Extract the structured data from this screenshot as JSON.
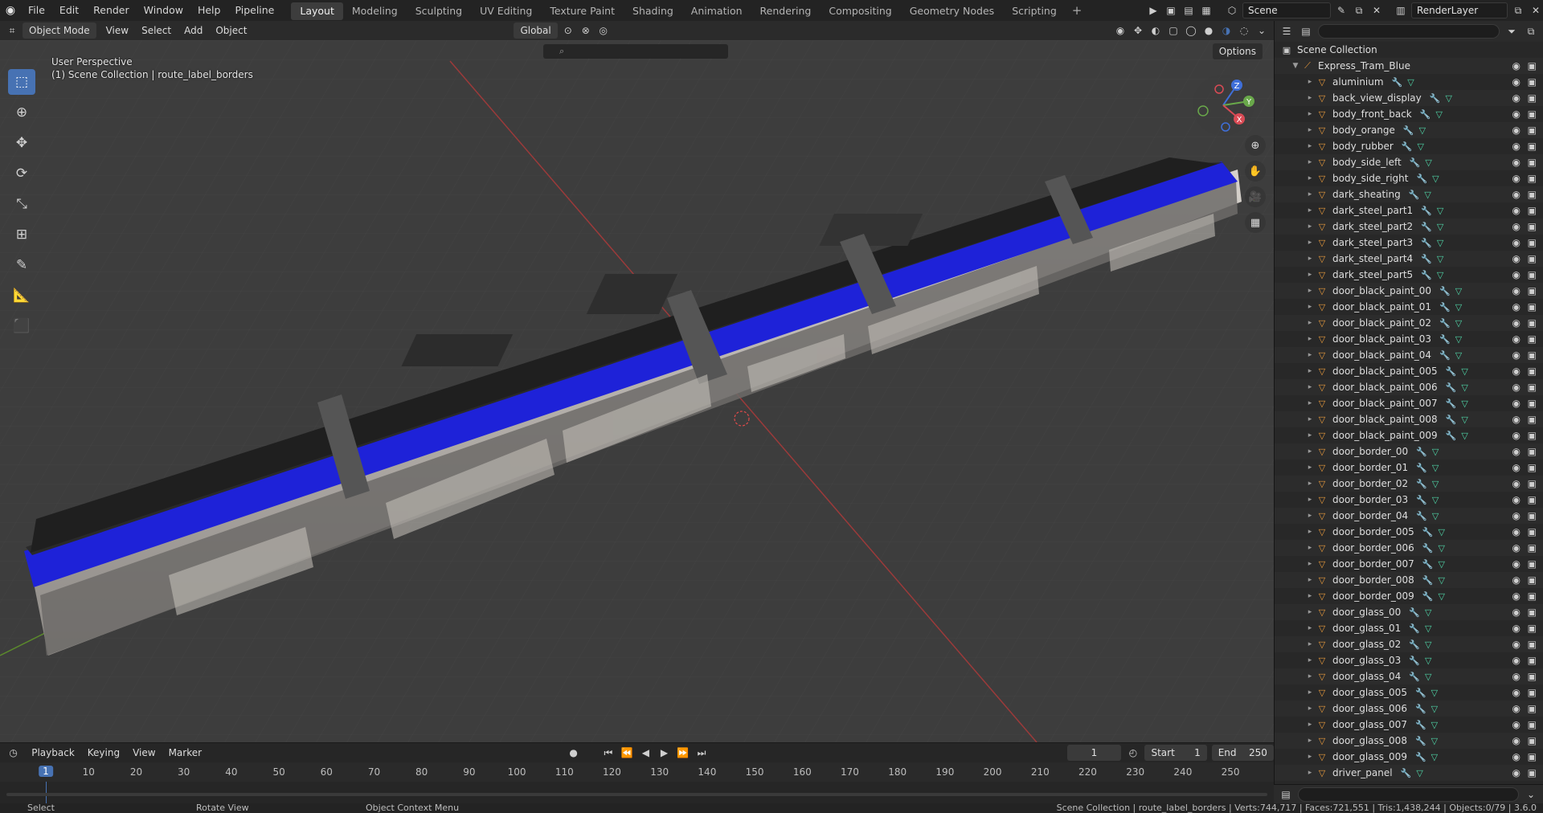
{
  "topbar": {
    "menus": [
      "File",
      "Edit",
      "Render",
      "Window",
      "Help",
      "Pipeline"
    ],
    "workspaces": [
      "Layout",
      "Modeling",
      "Sculpting",
      "UV Editing",
      "Texture Paint",
      "Shading",
      "Animation",
      "Rendering",
      "Compositing",
      "Geometry Nodes",
      "Scripting"
    ],
    "active_workspace": "Layout",
    "scene": "Scene",
    "view_layer": "RenderLayer"
  },
  "viewport": {
    "mode": "Object Mode",
    "menus": [
      "View",
      "Select",
      "Add",
      "Object"
    ],
    "transform_orientation": "Global",
    "options_label": "Options",
    "view_name": "User Perspective",
    "collection_path": "(1) Scene Collection | route_label_borders"
  },
  "outliner": {
    "root": "Scene Collection",
    "collection": "Express_Tram_Blue",
    "items": [
      "aluminium",
      "back_view_display",
      "body_front_back",
      "body_orange",
      "body_rubber",
      "body_side_left",
      "body_side_right",
      "dark_sheating",
      "dark_steel_part1",
      "dark_steel_part2",
      "dark_steel_part3",
      "dark_steel_part4",
      "dark_steel_part5",
      "door_black_paint_00",
      "door_black_paint_01",
      "door_black_paint_02",
      "door_black_paint_03",
      "door_black_paint_04",
      "door_black_paint_005",
      "door_black_paint_006",
      "door_black_paint_007",
      "door_black_paint_008",
      "door_black_paint_009",
      "door_border_00",
      "door_border_01",
      "door_border_02",
      "door_border_03",
      "door_border_04",
      "door_border_005",
      "door_border_006",
      "door_border_007",
      "door_border_008",
      "door_border_009",
      "door_glass_00",
      "door_glass_01",
      "door_glass_02",
      "door_glass_03",
      "door_glass_04",
      "door_glass_005",
      "door_glass_006",
      "door_glass_007",
      "door_glass_008",
      "door_glass_009",
      "driver_panel"
    ]
  },
  "timeline": {
    "menus": [
      "Playback",
      "Keying",
      "View",
      "Marker"
    ],
    "current_frame": "1",
    "start_label": "Start",
    "start": "1",
    "end_label": "End",
    "end": "250",
    "ruler": [
      "10",
      "20",
      "30",
      "40",
      "50",
      "60",
      "70",
      "80",
      "90",
      "100",
      "110",
      "120",
      "130",
      "140",
      "150",
      "160",
      "170",
      "180",
      "190",
      "200",
      "210",
      "220",
      "230",
      "240",
      "250"
    ]
  },
  "statusbar": {
    "select": "Select",
    "rotate": "Rotate View",
    "context": "Object Context Menu",
    "stats": "Scene Collection | route_label_borders | Verts:744,717 | Faces:721,551 | Tris:1,438,244 | Objects:0/79 | 3.6.0"
  },
  "colors": {
    "accent": "#4772b3",
    "tram_blue": "#1e22d8",
    "mesh_icon": "#e89a3c"
  }
}
